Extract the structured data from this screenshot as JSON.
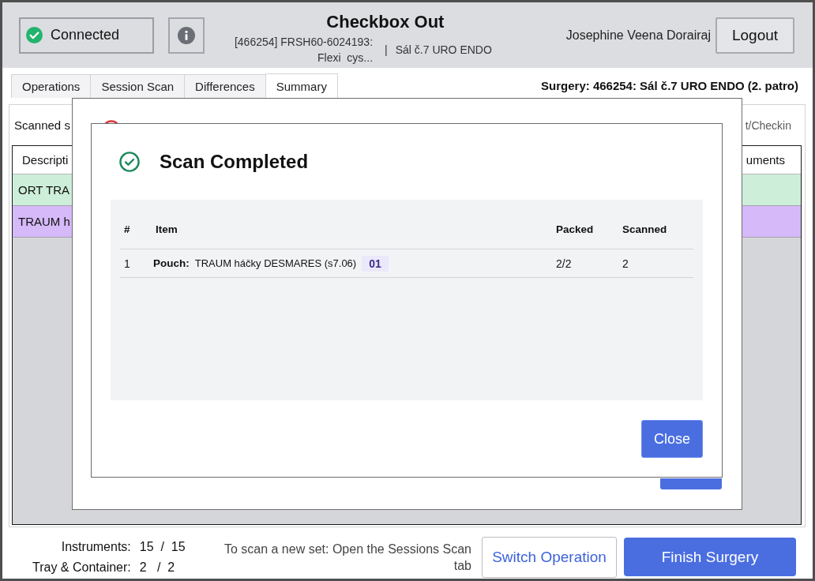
{
  "header": {
    "connection": {
      "label": "Connected",
      "connected": true
    },
    "title": "Checkbox Out",
    "subtitle": {
      "session_lines": [
        "[466254] FRSH60-6024193:",
        "Flexi  cys..."
      ],
      "separator": "|",
      "room": "Sál č.7 URO ENDO"
    },
    "user_name": "Josephine Veena Dorairaj",
    "logout_button": "Logout"
  },
  "tabs": [
    {
      "label": "Operations",
      "selected": false
    },
    {
      "label": "Session Scan",
      "selected": false
    },
    {
      "label": "Differences",
      "selected": false
    },
    {
      "label": "Summary",
      "selected": true
    }
  ],
  "surgery_label": "Surgery: 466254: Sál č.7 URO ENDO (2. patro)",
  "summary_panel": {
    "status_text": "Scanned s",
    "mode_text": "t/Checkin",
    "table": {
      "columns": [
        "Descripti",
        "uments"
      ],
      "rows": [
        {
          "description": "ORT TRA",
          "color": "#cdeed8"
        },
        {
          "description": "TRAUM h",
          "color": "#d5b9f8"
        }
      ]
    }
  },
  "dialog": {
    "title": "Scan Completed",
    "table": {
      "columns": [
        "#",
        "Item",
        "Packed",
        "Scanned"
      ],
      "rows": [
        {
          "index": "1",
          "type_label": "Pouch:",
          "name": "TRAUM háčky DESMARES (s7.06)",
          "badge": "01",
          "packed": "2/2",
          "scanned": "2"
        }
      ]
    },
    "close_button": "Close"
  },
  "footer": {
    "counts": [
      {
        "label": "Instruments:",
        "value": "15  /  15"
      },
      {
        "label": "Tray & Container:",
        "value": "2   /  2"
      }
    ],
    "hint": "To scan a new set: Open the Sessions Scan tab",
    "buttons": [
      {
        "label": "Switch Operation",
        "kind": "secondary"
      },
      {
        "label": "Finish Surgery",
        "kind": "primary"
      }
    ]
  }
}
